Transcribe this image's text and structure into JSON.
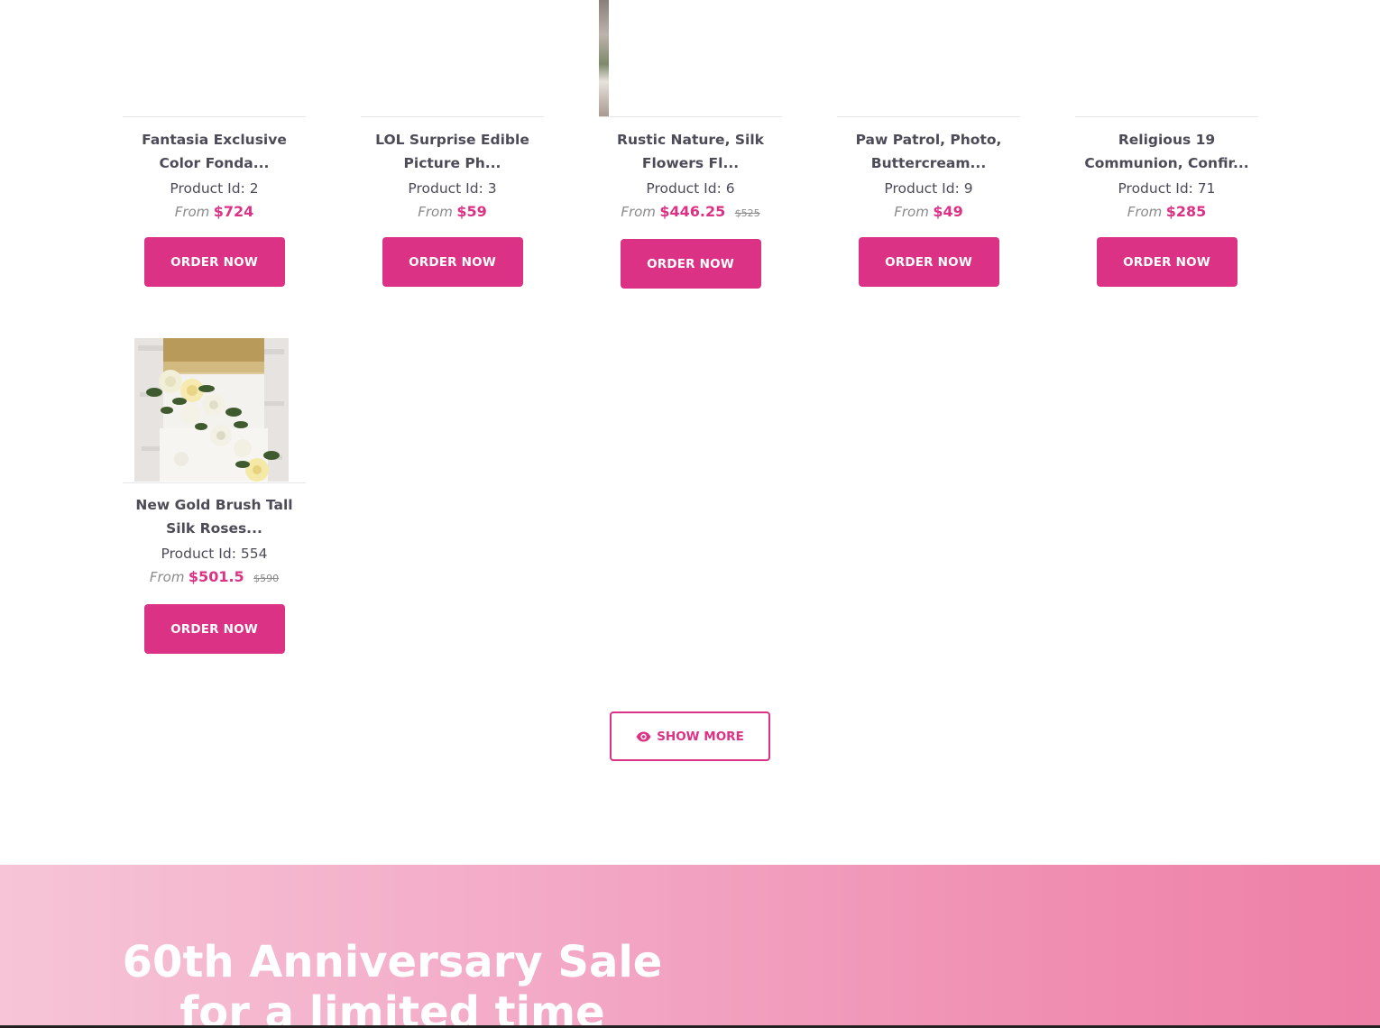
{
  "products_row1": [
    {
      "title": "Fantasia Exclusive Color Fonda...",
      "product_id": "Product Id: 2",
      "from": "From",
      "price": "$724",
      "old_price": "",
      "button": "ORDER NOW"
    },
    {
      "title": "LOL Surprise Edible Picture Ph...",
      "product_id": "Product Id: 3",
      "from": "From",
      "price": "$59",
      "old_price": "",
      "button": "ORDER NOW"
    },
    {
      "title": "Rustic Nature, Silk Flowers Fl...",
      "product_id": "Product Id: 6",
      "from": "From",
      "price": "$446.25",
      "old_price": "$525",
      "button": "ORDER NOW"
    },
    {
      "title": "Paw Patrol, Photo, Buttercream...",
      "product_id": "Product Id: 9",
      "from": "From",
      "price": "$49",
      "old_price": "",
      "button": "ORDER NOW"
    },
    {
      "title": "Religious 19 Communion, Confir...",
      "product_id": "Product Id: 71",
      "from": "From",
      "price": "$285",
      "old_price": "",
      "button": "ORDER NOW"
    }
  ],
  "products_row2": [
    {
      "title": "New Gold Brush Tall Silk Roses...",
      "product_id": "Product Id: 554",
      "from": "From",
      "price": "$501.5",
      "old_price": "$590",
      "button": "ORDER NOW"
    }
  ],
  "show_more": {
    "label": "SHOW MORE",
    "icon": "eye-icon"
  },
  "banner": {
    "title": "60th Anniversary Sale for a limited time"
  },
  "colors": {
    "accent": "#dc3285",
    "text": "#4c4c58",
    "muted": "#8a8a8a"
  }
}
